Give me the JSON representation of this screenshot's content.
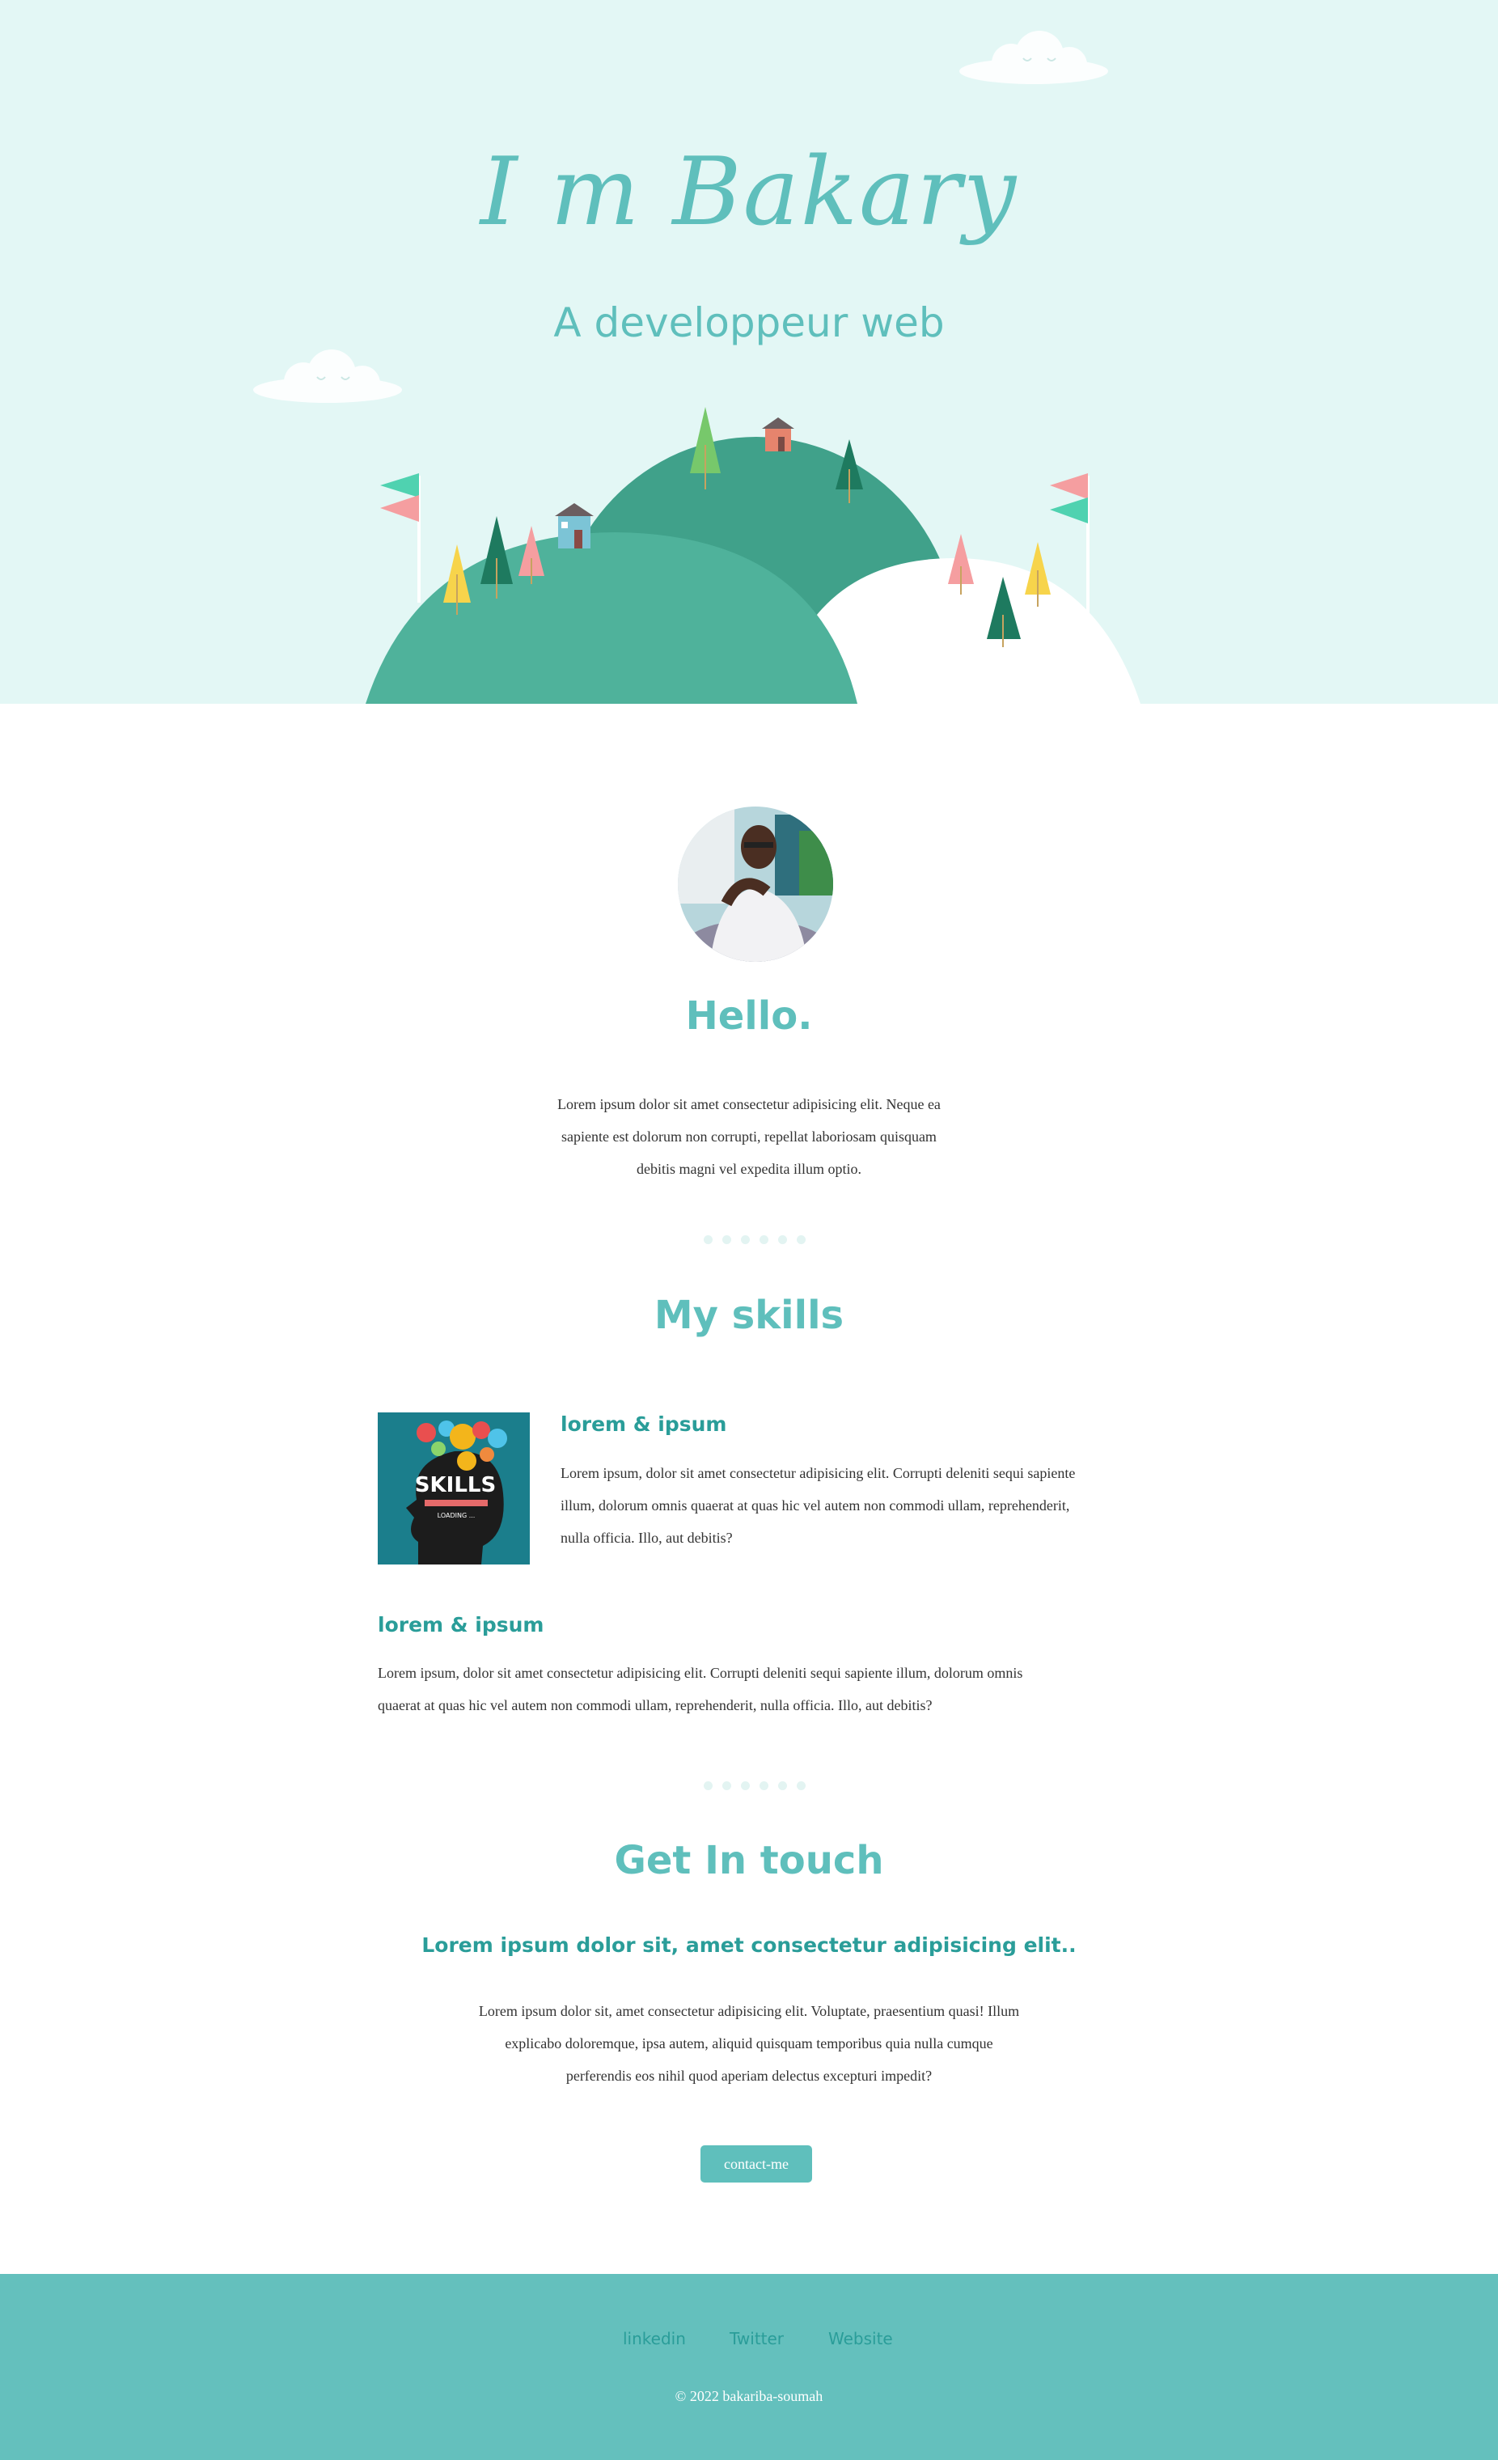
{
  "hero": {
    "title": "I m Bakary",
    "subtitle": "A developpeur web"
  },
  "about": {
    "heading": "Hello.",
    "text_lines": [
      "Lorem ipsum dolor sit amet consectetur adipisicing elit. Neque ea",
      "sapiente est dolorum non corrupti, repellat laboriosam quisquam",
      "debitis magni vel expedita illum optio."
    ]
  },
  "skills": {
    "heading": "My skills",
    "image_caption": "SKILLS",
    "image_loading": "LOADING ...",
    "item1": {
      "title": "lorem & ipsum",
      "text_lines": [
        "Lorem ipsum, dolor sit amet consectetur adipisicing elit. Corrupti deleniti sequi sapiente",
        "illum, dolorum omnis quaerat at quas hic vel autem non commodi ullam, reprehenderit,",
        "nulla officia. Illo, aut debitis?"
      ]
    },
    "item2": {
      "title": "lorem & ipsum",
      "text_lines": [
        "Lorem ipsum, dolor sit amet consectetur adipisicing elit. Corrupti deleniti sequi sapiente illum, dolorum omnis",
        "quaerat at quas hic vel autem non commodi ullam, reprehenderit, nulla officia. Illo, aut debitis?"
      ]
    }
  },
  "contact": {
    "heading": "Get In touch",
    "lead": "Lorem ipsum dolor sit, amet consectetur adipisicing elit..",
    "text_lines": [
      "Lorem ipsum dolor sit, amet consectetur adipisicing elit. Voluptate, praesentium quasi! Illum",
      "explicabo doloremque, ipsa autem, aliquid quisquam temporibus quia nulla cumque",
      "perferendis eos nihil quod aperiam delectus excepturi impedit?"
    ],
    "button_label": "contact-me"
  },
  "footer": {
    "links": [
      "linkedin",
      "Twitter",
      "Website"
    ],
    "copyright": "© 2022 bakariba-soumah"
  },
  "colors": {
    "accent": "#5fbfbc",
    "accent_dark": "#2a9d99",
    "hero_bg": "#e3f7f5",
    "footer_bg": "#64c0bd"
  }
}
